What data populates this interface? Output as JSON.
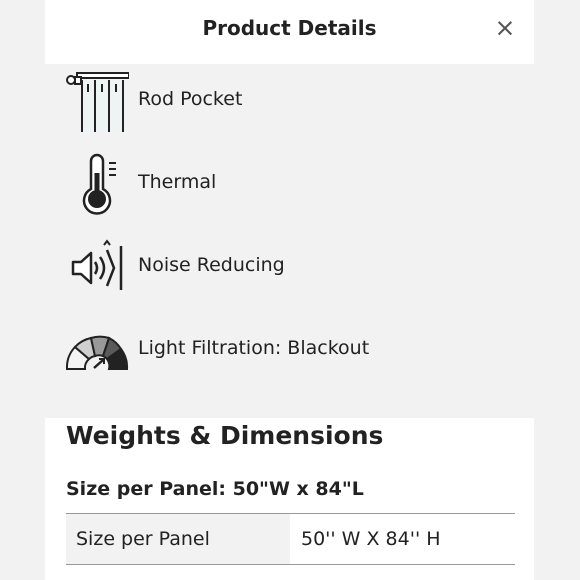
{
  "header": {
    "title": "Product Details",
    "close_symbol": "×"
  },
  "features": [
    {
      "label": "Rod Pocket",
      "icon": "rod-pocket-icon"
    },
    {
      "label": "Thermal",
      "icon": "thermometer-icon"
    },
    {
      "label": "Noise Reducing",
      "icon": "sound-reduction-icon"
    },
    {
      "label": "Light Filtration: Blackout",
      "icon": "light-gauge-icon"
    }
  ],
  "dimensions": {
    "title": "Weights & Dimensions",
    "subtitle": "Size per Panel: 50\"W x 84\"L",
    "rows": [
      {
        "key": "Size per Panel",
        "value": "50'' W X 84'' H"
      }
    ]
  },
  "colors": {
    "panel_bg": "#ffffff",
    "section_bg": "#f2f2f2",
    "text": "#222222"
  }
}
